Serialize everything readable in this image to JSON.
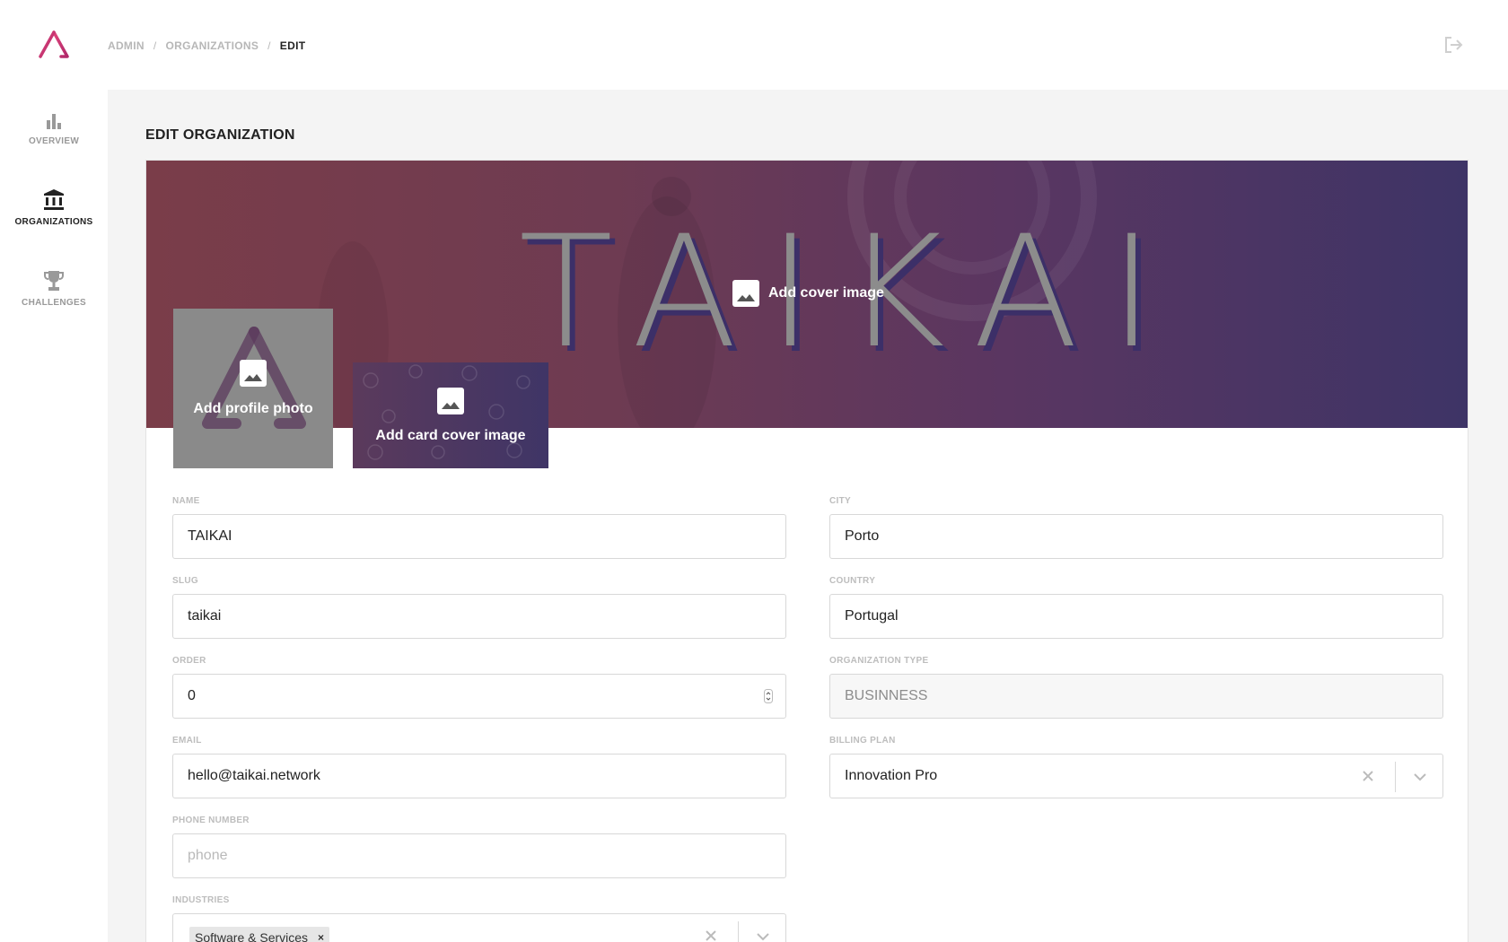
{
  "breadcrumb": {
    "items": [
      "ADMIN",
      "ORGANIZATIONS",
      "EDIT"
    ],
    "separator": "/"
  },
  "sidebar": {
    "items": [
      {
        "label": "OVERVIEW",
        "icon": "bar-chart-icon",
        "active": false
      },
      {
        "label": "ORGANIZATIONS",
        "icon": "bank-icon",
        "active": true
      },
      {
        "label": "CHALLENGES",
        "icon": "trophy-icon",
        "active": false
      }
    ]
  },
  "page": {
    "title": "EDIT ORGANIZATION"
  },
  "uploads": {
    "cover_label": "Add cover image",
    "cover_text": "TAIKAI",
    "profile_label": "Add profile photo",
    "card_cover_label": "Add card cover image"
  },
  "form": {
    "name": {
      "label": "NAME",
      "value": "TAIKAI"
    },
    "slug": {
      "label": "SLUG",
      "value": "taikai"
    },
    "order": {
      "label": "ORDER",
      "value": "0"
    },
    "email": {
      "label": "EMAIL",
      "value": "hello@taikai.network"
    },
    "phone": {
      "label": "PHONE NUMBER",
      "placeholder": "phone"
    },
    "industries": {
      "label": "INDUSTRIES",
      "tags": [
        "Software & Services"
      ]
    },
    "city": {
      "label": "CITY",
      "value": "Porto"
    },
    "country": {
      "label": "COUNTRY",
      "value": "Portugal"
    },
    "org_type": {
      "label": "ORGANIZATION TYPE",
      "value": "BUSINNESS"
    },
    "billing_plan": {
      "label": "BILLING PLAN",
      "value": "Innovation Pro"
    }
  },
  "colors": {
    "brand": "#d6336c",
    "cover_start": "#7a3d49",
    "cover_end": "#3e3466"
  }
}
